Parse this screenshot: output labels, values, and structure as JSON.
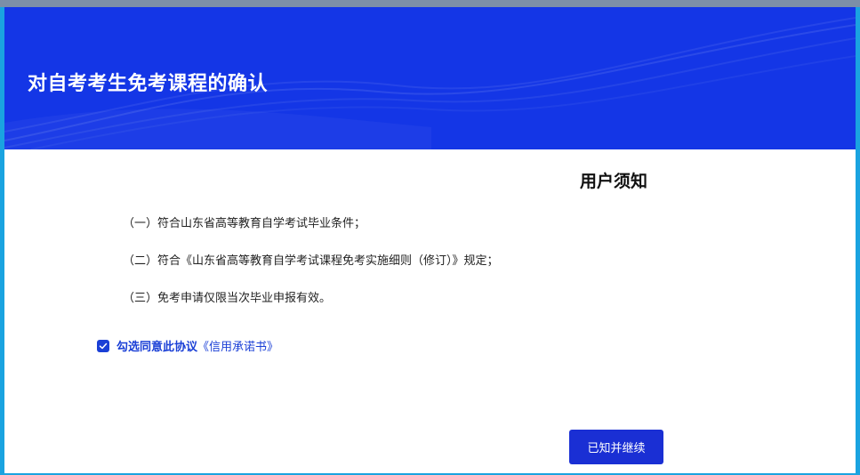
{
  "header": {
    "title": "对自考考生免考课程的确认",
    "background_color": "#1436e6"
  },
  "notice": {
    "heading": "用户须知",
    "items": [
      "（一）符合山东省高等教育自学考试毕业条件；",
      "（二）符合《山东省高等教育自学考试课程免考实施细则（修订）》规定；",
      "（三）免考申请仅限当次毕业申报有效。"
    ]
  },
  "agreement": {
    "checked": true,
    "label": "勾选同意此协议",
    "link_text": "《信用承诺书》"
  },
  "actions": {
    "continue_label": "已知并继续",
    "button_color": "#1a2fd4"
  },
  "icons": {
    "checkbox": "checkmark-icon"
  }
}
